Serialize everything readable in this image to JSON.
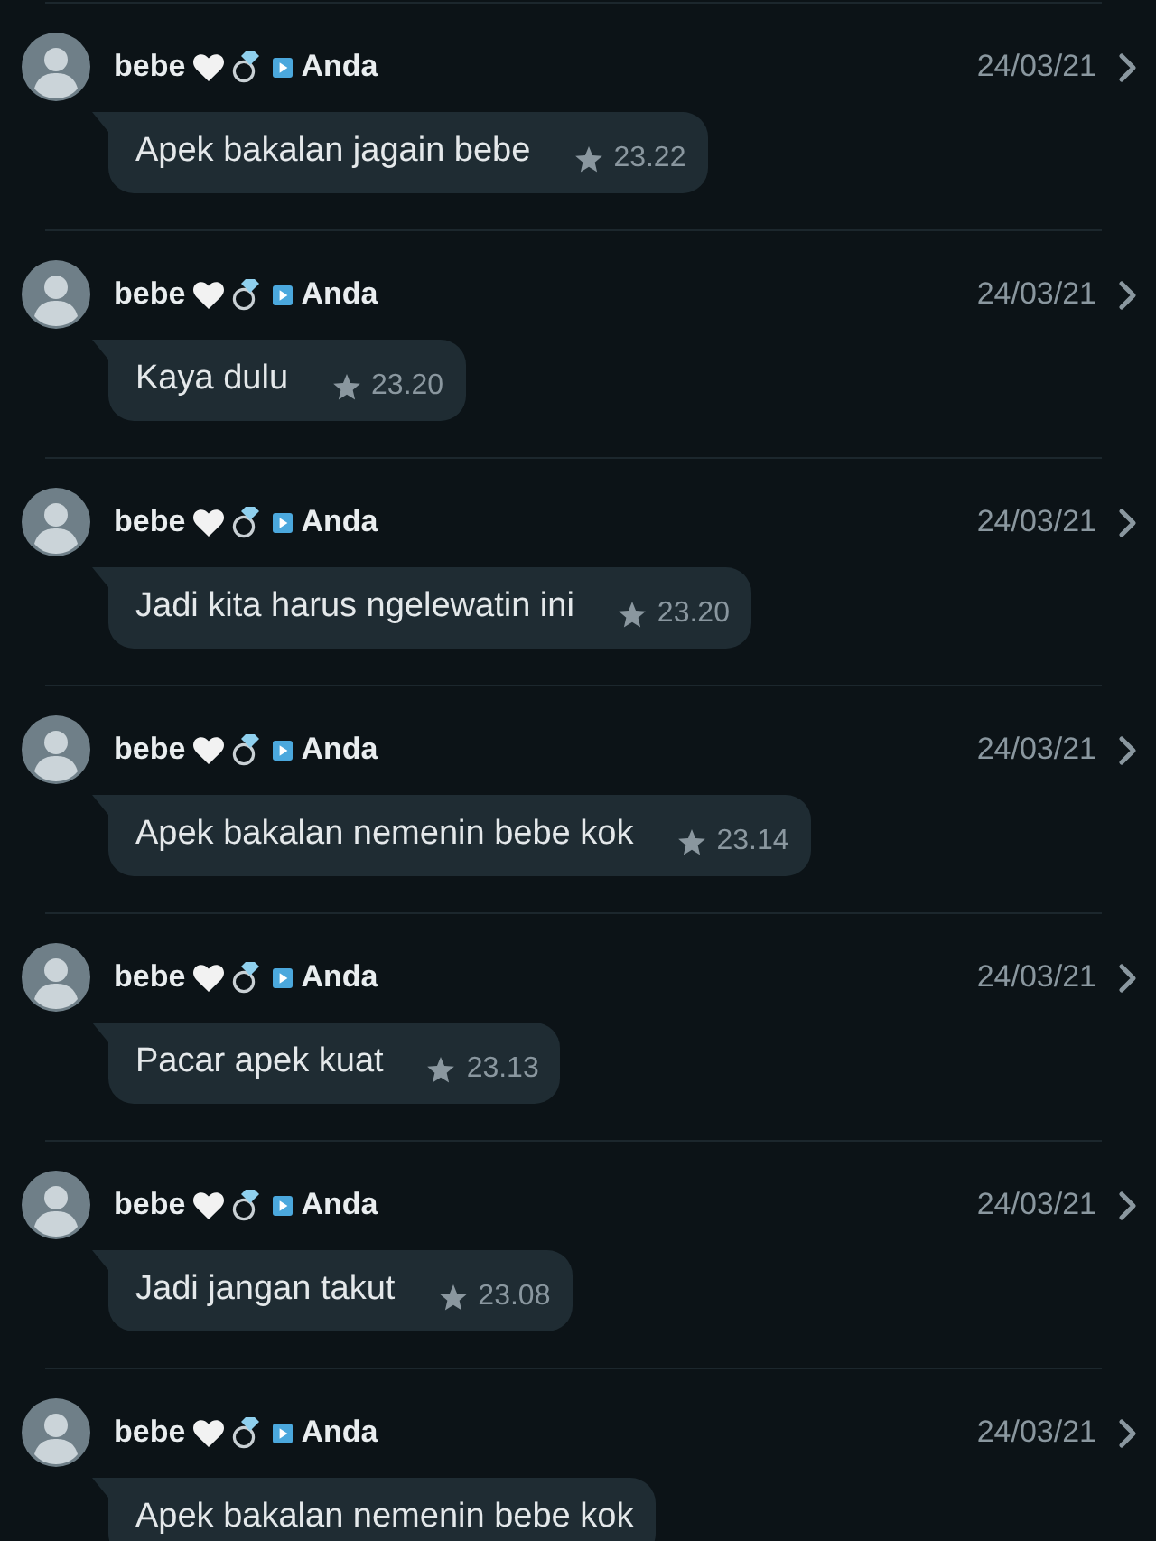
{
  "messages": [
    {
      "sender": "bebe",
      "recipient": "Anda",
      "date": "24/03/21",
      "text": "Apek bakalan jagain bebe",
      "time": "23.22",
      "starred": true
    },
    {
      "sender": "bebe",
      "recipient": "Anda",
      "date": "24/03/21",
      "text": "Kaya dulu",
      "time": "23.20",
      "starred": true
    },
    {
      "sender": "bebe",
      "recipient": "Anda",
      "date": "24/03/21",
      "text": "Jadi kita harus ngelewatin ini",
      "time": "23.20",
      "starred": true
    },
    {
      "sender": "bebe",
      "recipient": "Anda",
      "date": "24/03/21",
      "text": "Apek bakalan nemenin bebe kok",
      "time": "23.14",
      "starred": true
    },
    {
      "sender": "bebe",
      "recipient": "Anda",
      "date": "24/03/21",
      "text": "Pacar apek kuat",
      "time": "23.13",
      "starred": true
    },
    {
      "sender": "bebe",
      "recipient": "Anda",
      "date": "24/03/21",
      "text": "Jadi jangan takut",
      "time": "23.08",
      "starred": true
    },
    {
      "sender": "bebe",
      "recipient": "Anda",
      "date": "24/03/21",
      "text": "Apek bakalan nemenin bebe kok"
    }
  ]
}
